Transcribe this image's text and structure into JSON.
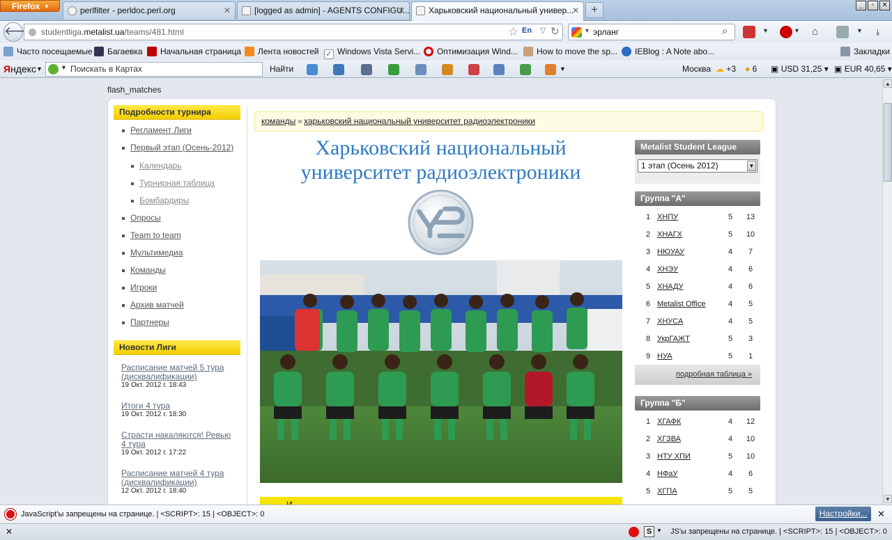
{
  "browser": {
    "app_button": "Firefox",
    "tabs": [
      {
        "label": "perlfilter - perldoc.perl.org",
        "active": false
      },
      {
        "label": "[logged as admin] - AGENTS CONFIGU...",
        "active": false
      },
      {
        "label": "Харьковский национальный универ...",
        "active": true
      }
    ],
    "new_tab": "+",
    "url_prefix": "studentliga.",
    "url_domain": "metalist.ua",
    "url_path": "/teams/481.html",
    "url_lang": "En",
    "search_query": "эрланг",
    "window_buttons": {
      "minimize": "_",
      "maximize": "▫",
      "close": "✕"
    }
  },
  "bookmarks": [
    {
      "label": "Часто посещаемые",
      "icon": "magnifier-icon"
    },
    {
      "label": "Багаевка",
      "icon": "bug-icon"
    },
    {
      "label": "Начальная страница",
      "icon": "red-animal-icon"
    },
    {
      "label": "Лента новостей",
      "icon": "rss-icon"
    },
    {
      "label": "Windows Vista Servi...",
      "icon": "checkmark-icon"
    },
    {
      "label": "Оптимизация Wind...",
      "icon": "opera-icon"
    },
    {
      "label": "How to move the sp...",
      "icon": "person-icon"
    },
    {
      "label": "IEBlog : A Note abo...",
      "icon": "ie-icon"
    },
    {
      "label": "Закладки",
      "icon": "bookmarks-icon"
    }
  ],
  "yandex_bar": {
    "logo_first": "Я",
    "logo_rest": "ндекс",
    "search_placeholder": "Поискать в Картах",
    "find_label": "Найти",
    "city": "Москва",
    "weather": "+3",
    "traffic": "6",
    "usd": "USD 31,25",
    "eur": "EUR 40,65"
  },
  "page": {
    "flash_label": "flash_matches",
    "left": {
      "tournament_heading": "Подробности турнира",
      "menu": [
        {
          "label": "Регламент Лиги",
          "sub": false
        },
        {
          "label": "Первый этап (Осень-2012)",
          "sub": false
        },
        {
          "label": "Календарь",
          "sub": true
        },
        {
          "label": "Турнирная таблица",
          "sub": true
        },
        {
          "label": "Бомбардиры",
          "sub": true
        },
        {
          "label": "Опросы",
          "sub": false
        },
        {
          "label": "Team to team",
          "sub": false
        },
        {
          "label": "Мультимедиа",
          "sub": false
        },
        {
          "label": "Команды",
          "sub": false
        },
        {
          "label": "Игроки",
          "sub": false
        },
        {
          "label": "Архив матчей",
          "sub": false
        },
        {
          "label": "Партнеры",
          "sub": false
        }
      ],
      "news_heading": "Новости Лиги",
      "news": [
        {
          "title": "Расписание матчей 5 тура (дисквалификации)",
          "date": "19 Окт. 2012 г. 18:43"
        },
        {
          "title": "Итоги 4 тура",
          "date": "19 Окт. 2012 г. 18:30"
        },
        {
          "title": "Страсти накаляются! Ревью 4 тура",
          "date": "19 Окт. 2012 г. 17:22"
        },
        {
          "title": "Расписание матчей 4 тура (дисквалификации)",
          "date": "12 Окт. 2012 г. 18:40"
        }
      ]
    },
    "breadcrumb": {
      "root": "команды",
      "separator": "»",
      "current": "харьковский национальный университет радиоэлектроники"
    },
    "team_title": "Харьковский национальный университет радиоэлектроники",
    "team_logo_text": "УР",
    "band_text": "И",
    "sidebar": {
      "league_heading": "Metalist Student League",
      "stage_selected": "1 этап (Осень 2012)",
      "group_a_heading": "Группа \"А\"",
      "group_a": [
        {
          "pos": "1",
          "team": "ХНПУ",
          "games": "5",
          "points": "13"
        },
        {
          "pos": "2",
          "team": "ХНАГХ",
          "games": "5",
          "points": "10"
        },
        {
          "pos": "3",
          "team": "НЮУАУ",
          "games": "4",
          "points": "7"
        },
        {
          "pos": "4",
          "team": "ХНЭУ",
          "games": "4",
          "points": "6"
        },
        {
          "pos": "5",
          "team": "ХНАДУ",
          "games": "4",
          "points": "6"
        },
        {
          "pos": "6",
          "team": "Metalist Office",
          "games": "4",
          "points": "5"
        },
        {
          "pos": "7",
          "team": "ХНУСА",
          "games": "4",
          "points": "5"
        },
        {
          "pos": "8",
          "team": "УкрГАЖТ",
          "games": "5",
          "points": "3"
        },
        {
          "pos": "9",
          "team": "НУА",
          "games": "5",
          "points": "1"
        }
      ],
      "details_link": "подробная таблица »",
      "group_b_heading": "Группа \"Б\"",
      "group_b": [
        {
          "pos": "1",
          "team": "ХГАФК",
          "games": "4",
          "points": "12"
        },
        {
          "pos": "2",
          "team": "ХГЗВА",
          "games": "4",
          "points": "10"
        },
        {
          "pos": "3",
          "team": "НТУ ХПИ",
          "games": "5",
          "points": "10"
        },
        {
          "pos": "4",
          "team": "НФаУ",
          "games": "4",
          "points": "6"
        },
        {
          "pos": "5",
          "team": "ХГПА",
          "games": "5",
          "points": "5"
        }
      ]
    }
  },
  "notice_bar": {
    "message": "JavaScript'ы запрещены на странице. | <SCRIPT>: 15 | <OBJECT>: 0",
    "settings_button": "Настройки...",
    "close": "✕"
  },
  "status_bar": {
    "close": "✕",
    "s_label": "S",
    "message": "JS'ы запрещены на странице. | <SCRIPT>: 15 | <OBJECT>: 0"
  },
  "colors": {
    "section_heading": "#f5d600",
    "title_blue": "#2f7ac2",
    "sidebar_heading": "#7f7f7f",
    "noscript_red": "#dd1111"
  }
}
